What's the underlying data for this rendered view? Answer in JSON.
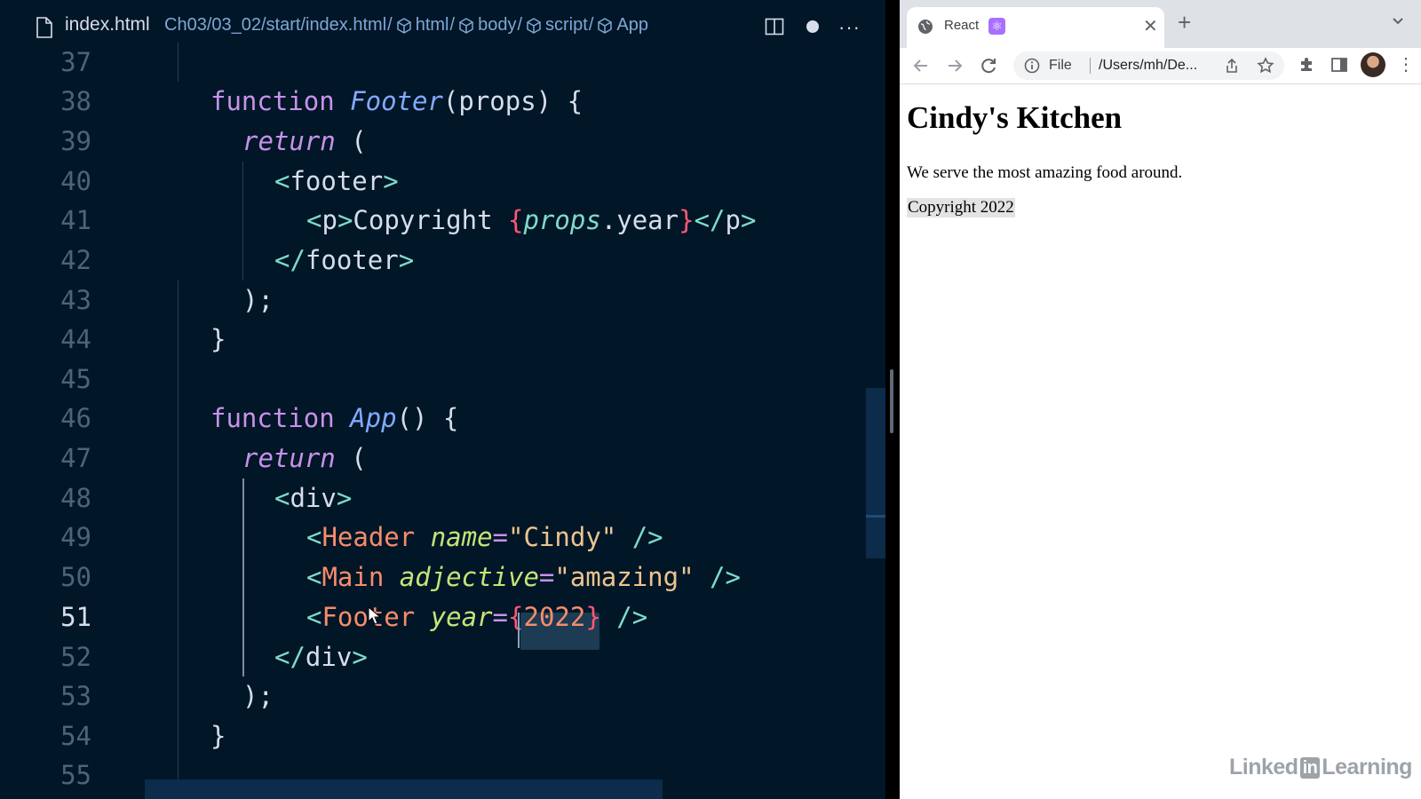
{
  "editor": {
    "file_name": "index.html",
    "breadcrumbs": [
      "Ch03/03_02/start/index.html",
      "html",
      "body",
      "script",
      "App"
    ],
    "active_line": 51,
    "lines": [
      {
        "n": "37"
      },
      {
        "n": "38",
        "t": [
          "function",
          "Footer",
          "(props) {"
        ]
      },
      {
        "n": "39",
        "t": [
          "return",
          " ("
        ]
      },
      {
        "n": "40",
        "t": [
          "<",
          "footer",
          ">"
        ]
      },
      {
        "n": "41",
        "t": [
          "<",
          "p",
          ">",
          "Copyright ",
          "{",
          "props",
          ".year",
          "}",
          "</",
          "p",
          ">"
        ]
      },
      {
        "n": "42",
        "t": [
          "</",
          "footer",
          ">"
        ]
      },
      {
        "n": "43",
        "t": [
          ");"
        ]
      },
      {
        "n": "44",
        "t": [
          "}"
        ]
      },
      {
        "n": "45"
      },
      {
        "n": "46",
        "t": [
          "function",
          "App",
          "() {"
        ]
      },
      {
        "n": "47",
        "t": [
          "return",
          " ("
        ]
      },
      {
        "n": "48",
        "t": [
          "<",
          "div",
          ">"
        ]
      },
      {
        "n": "49",
        "t": [
          "<",
          "Header",
          "name",
          "=",
          "\"Cindy\"",
          "/>"
        ]
      },
      {
        "n": "50",
        "t": [
          "<",
          "Main",
          "adjective",
          "=",
          "\"amazing\"",
          "/>"
        ]
      },
      {
        "n": "51",
        "t": [
          "<",
          "Footer",
          "year",
          "=",
          "{",
          "2022",
          "}",
          "/>"
        ]
      },
      {
        "n": "52",
        "t": [
          "</",
          "div",
          ">"
        ]
      },
      {
        "n": "53",
        "t": [
          ");"
        ]
      },
      {
        "n": "54",
        "t": [
          "}"
        ]
      },
      {
        "n": "55"
      }
    ]
  },
  "browser": {
    "tab_title": "React",
    "tab_badge": "⚛",
    "url_scheme": "File",
    "url_path": "/Users/mh/De...",
    "page": {
      "heading": "Cindy's Kitchen",
      "paragraph": "We serve the most amazing food around.",
      "footer": "Copyright 2022"
    }
  },
  "watermark": {
    "left": "Linked",
    "in": "in",
    "right": "Learning"
  },
  "colors": {
    "editor_bg": "#011627",
    "keyword": "#c792ea",
    "function": "#82aaff",
    "tag_bracket": "#7fdbca",
    "component": "#f78c6c",
    "attribute": "#c5e478",
    "string": "#ecc48d",
    "brace": "#ff5874"
  }
}
